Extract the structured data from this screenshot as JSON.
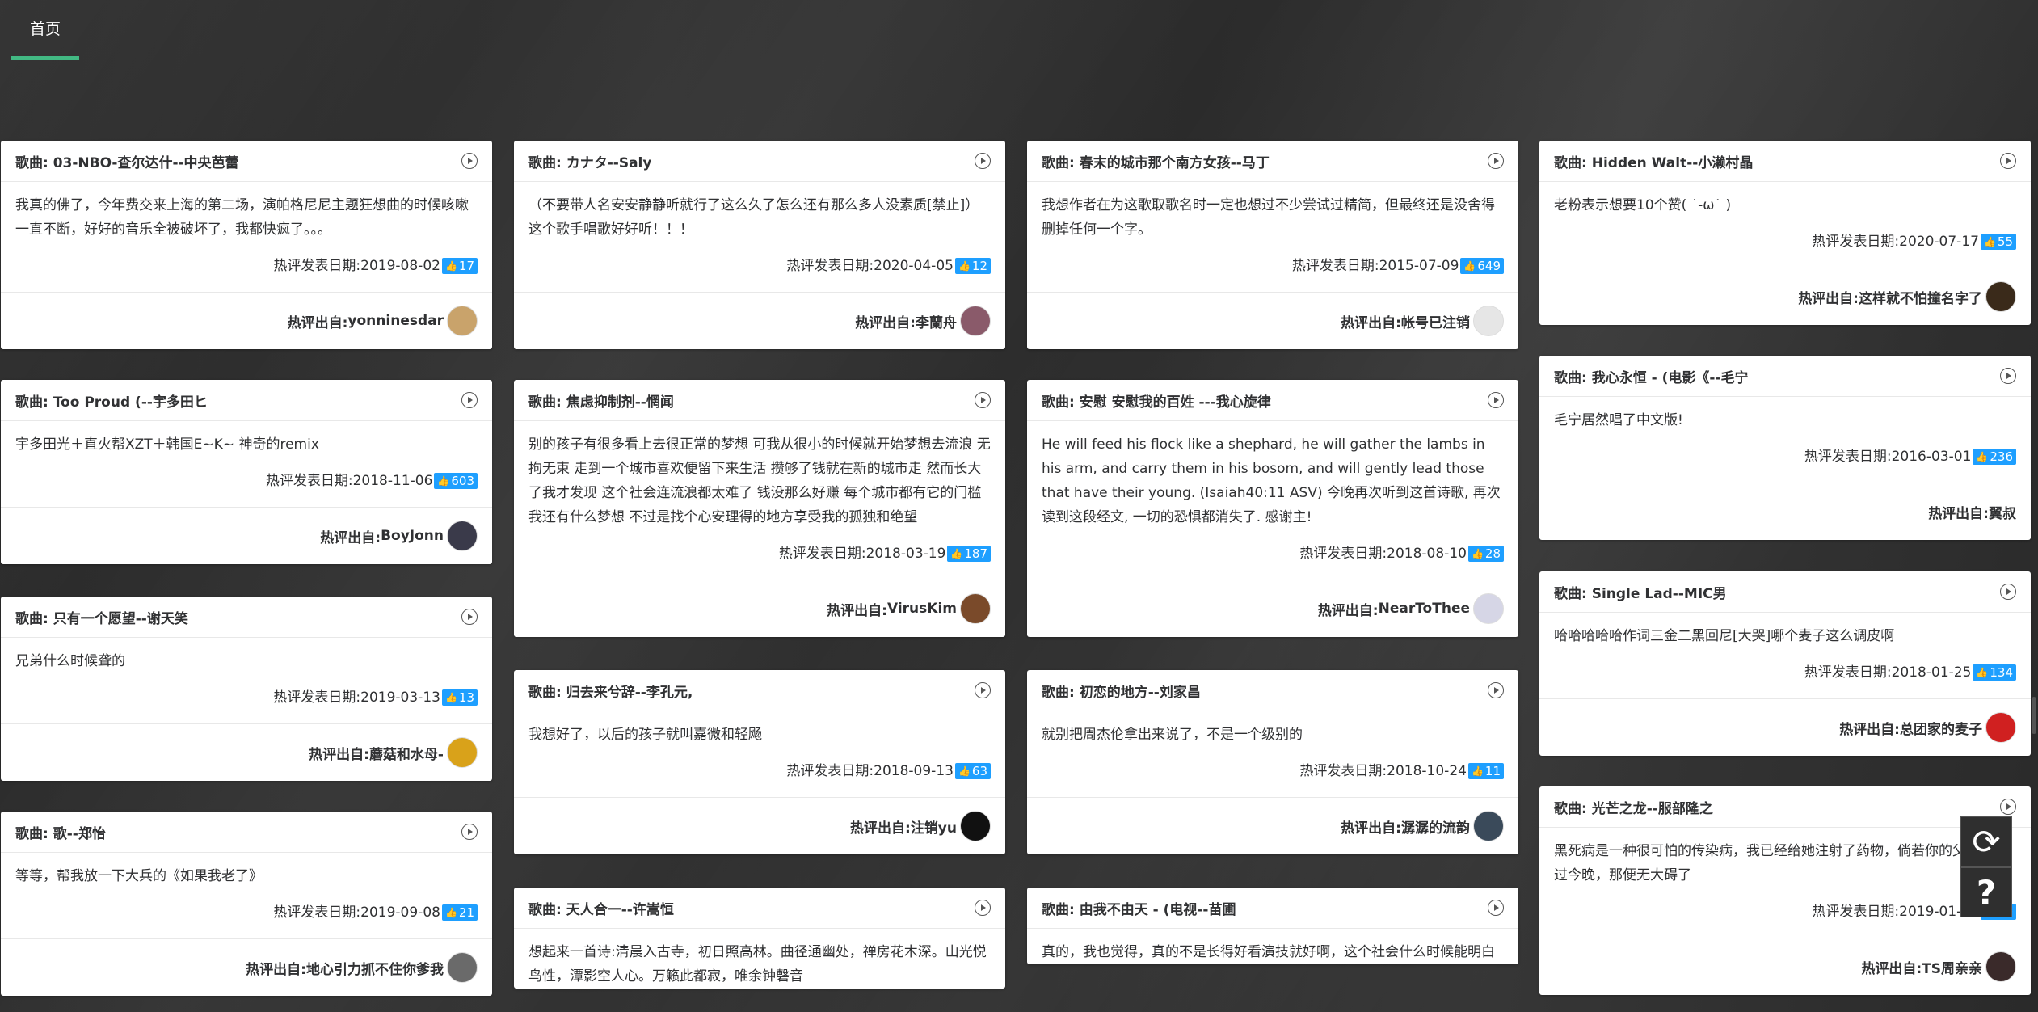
{
  "nav": {
    "tab_label": "首页"
  },
  "labels": {
    "song_prefix": "歌曲: ",
    "date_prefix": "热评发表日期: ",
    "author_prefix": "热评出自: "
  },
  "columns": [
    [
      {
        "song": "03-NBO-查尔达什--中央芭蕾",
        "comment": "我真的佛了，今年费交来上海的第二场，演帕格尼尼主题狂想曲的时候咳嗽一直不断，好好的音乐全被破坏了，我都快疯了。。。",
        "date": "2019-08-02",
        "likes": "17",
        "author": "yonninesdar",
        "avatar_color": "#c9a36b"
      },
      {
        "song": "Too Proud (--宇多田ヒ",
        "comment": "宇多田光＋直火帮XZT＋韩国E~K~ 神奇的remix",
        "date": "2018-11-06",
        "likes": "603",
        "author": "BoyJonn",
        "avatar_color": "#3a3a4a"
      },
      {
        "song": "只有一个愿望--谢天笑",
        "comment": "兄弟什么时候聋的",
        "date": "2019-03-13",
        "likes": "13",
        "author": "蘑菇和水母-",
        "avatar_color": "#d9a21a"
      },
      {
        "song": "歌--郑怡",
        "comment": "等等，帮我放一下大兵的《如果我老了》",
        "date": "2019-09-08",
        "likes": "21",
        "author": "地心引力抓不住你爹我",
        "avatar_color": "#6a6a6a"
      }
    ],
    [
      {
        "song": "カナタ--Saly",
        "comment": "（不要带人名安安静静听就行了这么久了怎么还有那么多人没素质[禁止]）这个歌手唱歌好好听！！！",
        "date": "2020-04-05",
        "likes": "12",
        "author": "李蘭舟",
        "avatar_color": "#8a5a6a"
      },
      {
        "song": "焦虑抑制剂--惘闻",
        "comment": "别的孩子有很多看上去很正常的梦想 可我从很小的时候就开始梦想去流浪 无拘无束 走到一个城市喜欢便留下来生活 攒够了钱就在新的城市走 然而长大了我才发现 这个社会连流浪都太难了 钱没那么好赚 每个城市都有它的门槛 我还有什么梦想 不过是找个心安理得的地方享受我的孤独和绝望",
        "date": "2018-03-19",
        "likes": "187",
        "author": "VirusKim",
        "avatar_color": "#7a4a2a"
      },
      {
        "song": "归去来兮辞--李孔元,",
        "comment": "我想好了，以后的孩子就叫嘉微和轻飏",
        "date": "2018-09-13",
        "likes": "63",
        "author": "注销yu",
        "avatar_color": "#111111"
      },
      {
        "song": "天人合一--许嵩恒",
        "comment": "想起来一首诗:清晨入古寺，初日照高林。曲径通幽处，禅房花木深。山光悦鸟性，潭影空人心。万籁此都寂，唯余钟磬音",
        "date": "",
        "likes": "",
        "author": "",
        "avatar_color": "#999999"
      }
    ],
    [
      {
        "song": "春末的城市那个南方女孩--马丁",
        "comment": "我想作者在为这歌取歌名时一定也想过不少尝试过精简，但最终还是没舍得删掉任何一个字。",
        "date": "2015-07-09",
        "likes": "649",
        "author": "帐号已注销",
        "avatar_color": "#e6e6e6"
      },
      {
        "song": "安慰 安慰我的百姓 ---我心旋律",
        "comment": "He will feed his flock like a shephard, he will gather the lambs in his arm, and carry them in his bosom, and will gently lead those that have their young. (Isaiah40:11 ASV) 今晚再次听到这首诗歌, 再次读到这段经文, 一切的恐惧都消失了. 感谢主!",
        "date": "2018-08-10",
        "likes": "28",
        "author": "NearToThee",
        "avatar_color": "#d6d6e6"
      },
      {
        "song": "初恋的地方--刘家昌",
        "comment": "就别把周杰伦拿出来说了，不是一个级别的",
        "date": "2018-10-24",
        "likes": "11",
        "author": "潺潺的流韵",
        "avatar_color": "#3a4a5a"
      },
      {
        "song": "由我不由天 - (电视--苗圃",
        "comment": "真的，我也觉得，真的不是长得好看演技就好啊，这个社会什么时候能明白",
        "date": "",
        "likes": "",
        "author": "",
        "avatar_color": "#999999"
      }
    ],
    [
      {
        "song": "Hidden Walt--小濑村晶",
        "comment": "老粉表示想要10个赞( ˙-ω˙ )",
        "date": "2020-07-17",
        "likes": "55",
        "author": "这样就不怕撞名字了",
        "avatar_color": "#3a2a1a"
      },
      {
        "song": "我心永恒 - (电影《--毛宁",
        "comment": "毛宁居然唱了中文版!",
        "date": "2016-03-01",
        "likes": "236",
        "author": "翼叔",
        "avatar_color": ""
      },
      {
        "song": " Single Lad--MIC男",
        "comment": "哈哈哈哈哈作词三金二黑回尼[大哭]哪个麦子这么调皮啊",
        "date": "2018-01-25",
        "likes": "134",
        "author": "总团家的麦子",
        "avatar_color": "#d02020"
      },
      {
        "song": "光芒之龙--服部隆之",
        "comment": "黑死病是一种很可怕的传染病，我已经给她注射了药物，倘若你的父亲不扛过今晚，那便无大碍了",
        "date": "2019-01-23",
        "likes": "10",
        "author": "TS周亲亲",
        "avatar_color": "#3a2a2a"
      }
    ]
  ],
  "side_buttons": {
    "refresh_glyph": "⟳",
    "help_glyph": "?"
  }
}
